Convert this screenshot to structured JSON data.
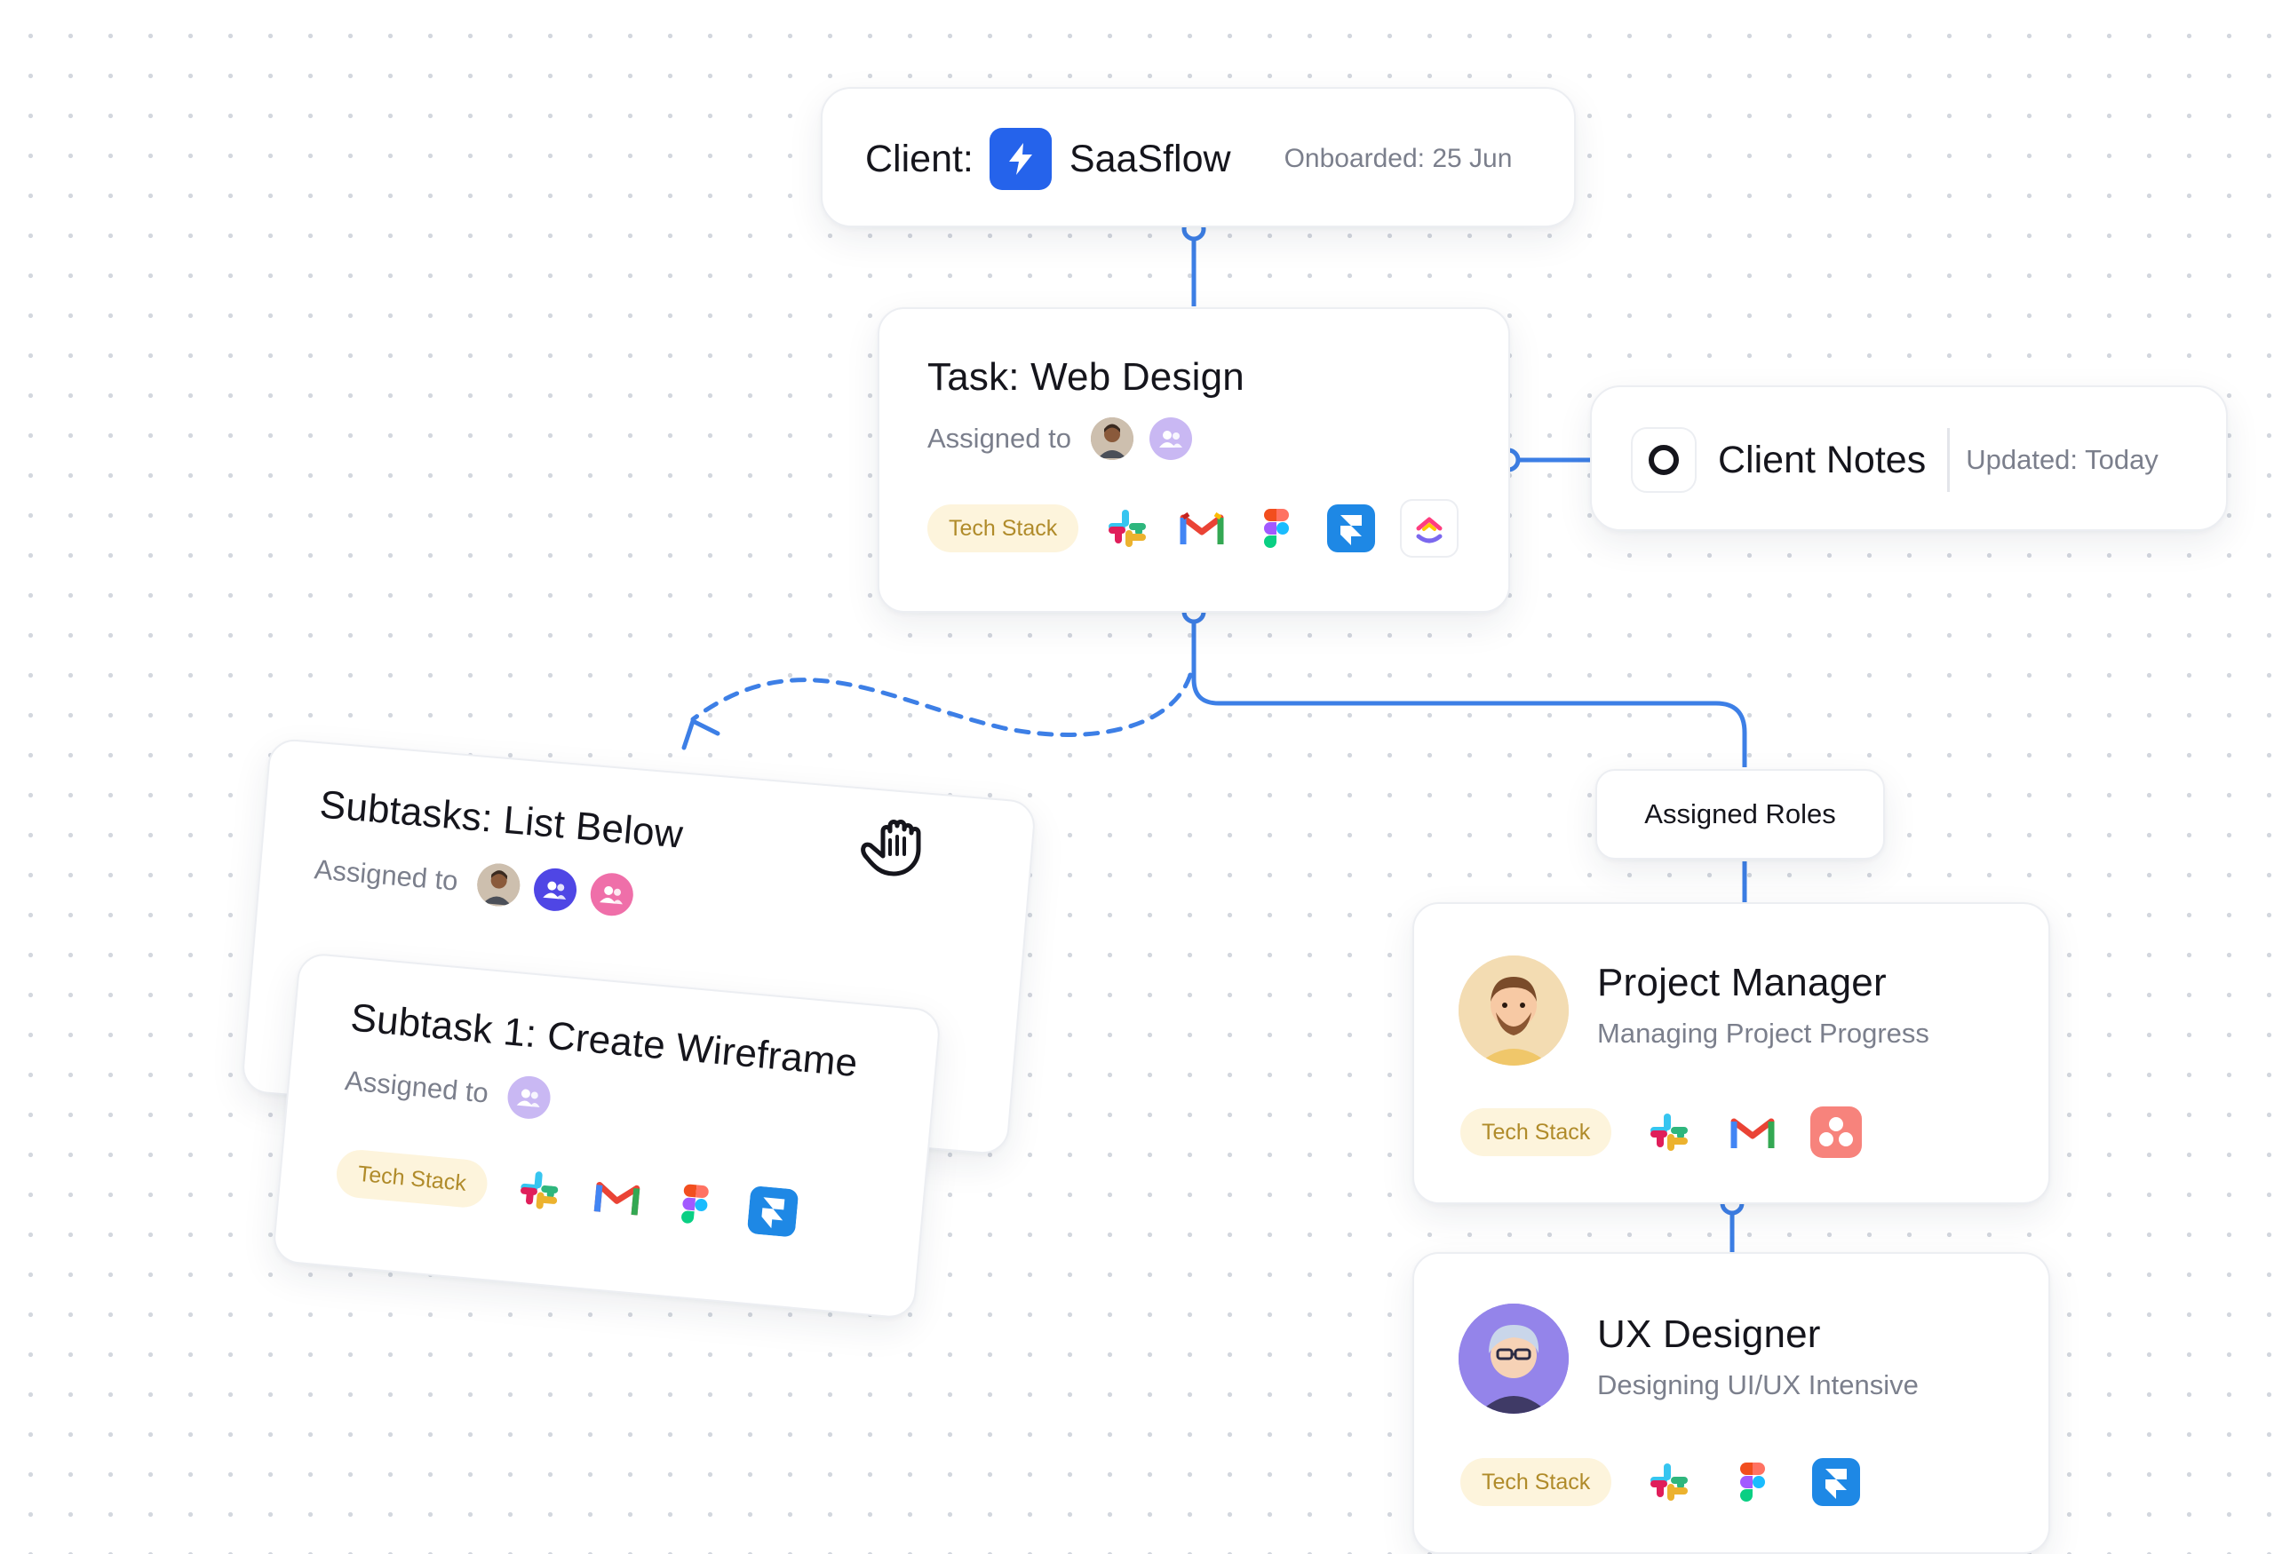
{
  "client": {
    "label": "Client:",
    "name": "SaaSflow",
    "onboarded": "Onboarded: 25 Jun"
  },
  "task": {
    "title": "Task: Web Design",
    "assigned_label": "Assigned to",
    "tech_stack": "Tech Stack",
    "tools": [
      "slack-icon",
      "gmail-icon",
      "figma-icon",
      "framer-icon",
      "clickup-icon"
    ]
  },
  "notes": {
    "title": "Client Notes",
    "updated": "Updated: Today"
  },
  "subtasks": {
    "title": "Subtasks: List Below",
    "assigned_label": "Assigned to"
  },
  "subtask1": {
    "title": "Subtask 1: Create Wireframe",
    "assigned_label": "Assigned to",
    "tech_stack": "Tech Stack",
    "tools": [
      "slack-icon",
      "gmail-icon",
      "figma-icon",
      "framer-icon"
    ]
  },
  "roles": {
    "label": "Assigned Roles"
  },
  "pm": {
    "title": "Project Manager",
    "subtitle": "Managing Project Progress",
    "tech_stack": "Tech Stack",
    "tools": [
      "slack-icon",
      "gmail-icon",
      "asana-icon"
    ]
  },
  "ux": {
    "title": "UX Designer",
    "subtitle": "Designing UI/UX Intensive",
    "tech_stack": "Tech Stack",
    "tools": [
      "slack-icon",
      "figma-icon",
      "framer-icon"
    ]
  },
  "colors": {
    "accent": "#3d7fe6",
    "brand": "#2563eb",
    "chip_bg": "#fdf4dc",
    "chip_text": "#b08b2a"
  }
}
